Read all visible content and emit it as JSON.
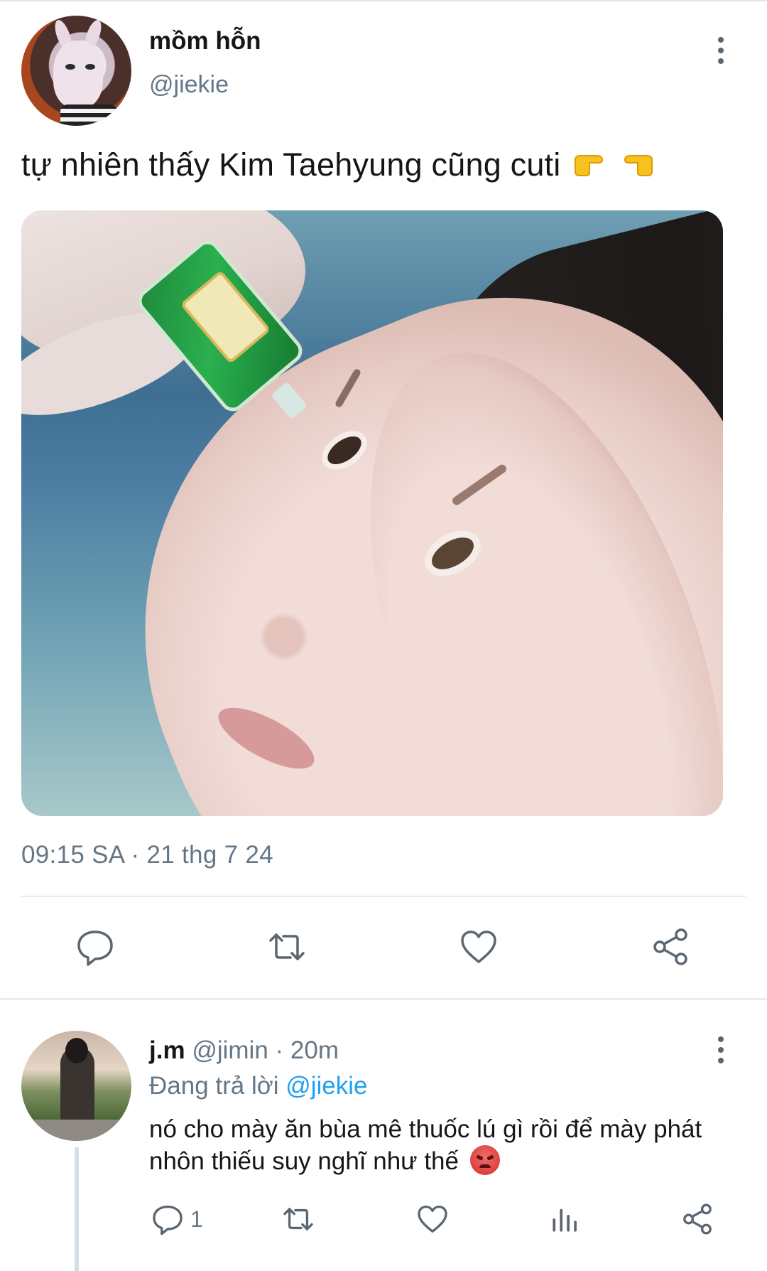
{
  "tweet": {
    "display_name": "mồm hỗn",
    "handle": "@jiekie",
    "text": "tự nhiên thấy Kim Taehyung cũng cuti",
    "emojis": [
      "backhand-index-pointing-right",
      "backhand-index-pointing-left"
    ],
    "timestamp": "09:15 SA · 21 thg 7 24",
    "actions": [
      "reply-icon",
      "retweet-icon",
      "like-icon",
      "share-icon"
    ]
  },
  "reply": {
    "display_name": "j.m",
    "handle": "@jimin",
    "time": "· 20m",
    "replying_prefix": "Đang trả lời",
    "replying_to": "@jiekie",
    "text": "nó cho mày ăn bùa mê thuốc lú gì rồi để mày phát nhôn thiếu suy nghĩ như thế",
    "emoji": "pouting-face",
    "reply_count": "1",
    "actions": [
      "reply-icon",
      "retweet-icon",
      "like-icon",
      "analytics-icon",
      "share-icon"
    ]
  },
  "colors": {
    "text": "#14171a",
    "secondary": "#657786",
    "link": "#1da1f2",
    "divider": "#e6ecf0",
    "icon": "#5b6670"
  }
}
